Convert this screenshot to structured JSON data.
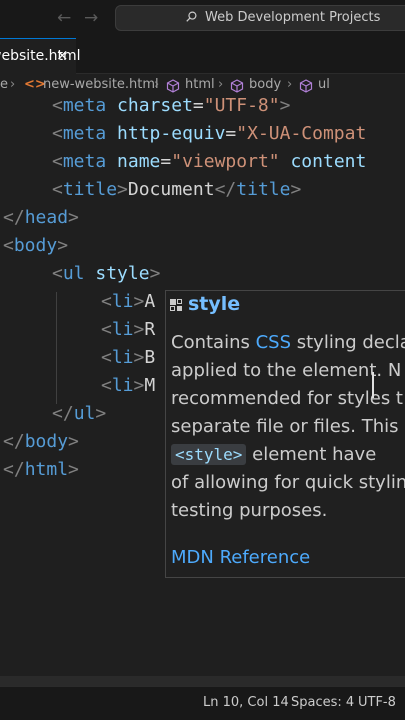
{
  "titlebar": {
    "search_text": "Web Development Projects"
  },
  "tab": {
    "label": "website.html",
    "close": "×"
  },
  "breadcrumb": [
    "e",
    "new-website.html",
    "html",
    "body",
    "ul"
  ],
  "code_lines": {
    "l1": {
      "tag": "meta",
      "attr": "charset",
      "value": "\"UTF-8\""
    },
    "l2": {
      "tag": "meta",
      "attr": "http-equiv",
      "value": "\"X-UA-Compat"
    },
    "l3": {
      "tag": "meta",
      "attr1": "name",
      "value1": "\"viewport\"",
      "attr2": "content"
    },
    "l4": {
      "tag": "title",
      "text": "Document"
    },
    "l5": {
      "tag": "head"
    },
    "l6": {
      "tag": "body"
    },
    "l7": {
      "tag": "ul",
      "attr": "style"
    },
    "l8": {
      "tag": "li",
      "text": "A"
    },
    "l9": {
      "tag": "li",
      "text": "R"
    },
    "l10": {
      "tag": "li",
      "text": "B"
    },
    "l11": {
      "tag": "li",
      "text": "M"
    },
    "l12": {
      "tag": "ul"
    },
    "l13": {
      "tag": "body"
    },
    "l14": {
      "tag": "html"
    }
  },
  "hover": {
    "title": "style",
    "body_1a": "Contains ",
    "body_1b": "CSS",
    "body_1c": " styling decla",
    "body_2": "applied to the element. N",
    "body_3": "recommended for styles t",
    "body_4": "separate file or files. This a",
    "body_5_chip": "<style>",
    "body_5b": " element have",
    "body_6": "of allowing for quick stylin",
    "body_7": "testing purposes.",
    "reference": "MDN Reference"
  },
  "status": {
    "position": "Ln 10, Col 14",
    "spaces": "Spaces: 4",
    "encoding": "UTF-8"
  }
}
